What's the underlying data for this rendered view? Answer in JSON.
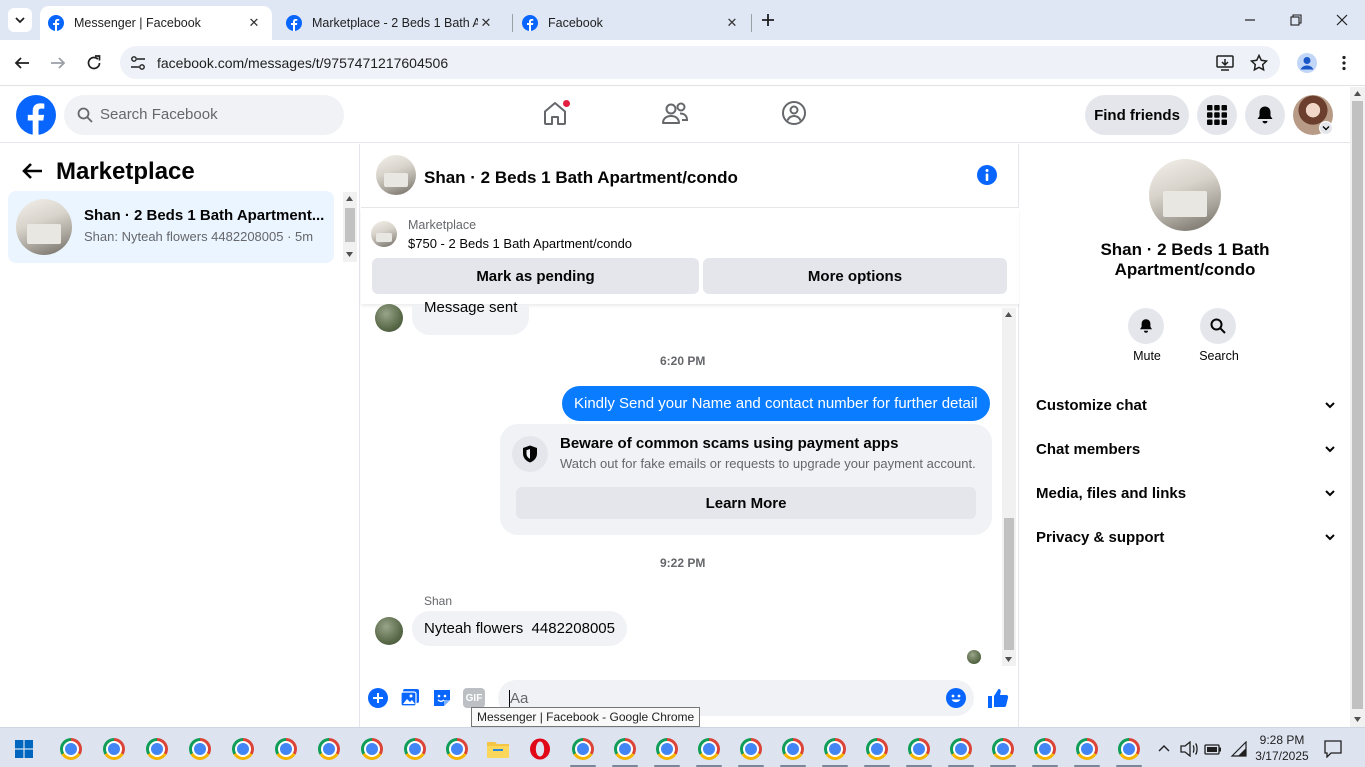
{
  "browser": {
    "tabs": [
      {
        "title": "Messenger | Facebook",
        "active": true
      },
      {
        "title": "Marketplace - 2 Beds 1 Bath Ap",
        "active": false
      },
      {
        "title": "Facebook",
        "active": false
      }
    ],
    "url": "facebook.com/messages/t/9757471217604506"
  },
  "fb_header": {
    "search_placeholder": "Search Facebook",
    "find_friends_label": "Find friends",
    "brand_color": "#0866ff"
  },
  "left_panel": {
    "title": "Marketplace",
    "conversation": {
      "name": "Shan · 2 Beds 1 Bath Apartment...",
      "preview": "Shan: Nyteah flowers 4482208005",
      "time": "· 5m"
    }
  },
  "chat": {
    "header_name": "Shan · 2 Beds 1 Bath Apartment/condo",
    "listing": {
      "source": "Marketplace",
      "title": "$750 - 2 Beds 1 Bath Apartment/condo"
    },
    "buttons": {
      "mark_pending": "Mark as pending",
      "more_options": "More options"
    },
    "messages": {
      "partial_sent": "Message sent",
      "time_1": "6:20 PM",
      "outgoing": "Kindly Send your Name and contact number for further detail",
      "scam_warning": {
        "title": "Beware of common scams using payment apps",
        "body": "Watch out for fake emails or requests to upgrade your payment account.",
        "button": "Learn More"
      },
      "time_2": "9:22 PM",
      "sender": "Shan",
      "incoming": "Nyteah flowers  4482208005"
    },
    "composer_placeholder": "Aa"
  },
  "right_panel": {
    "name_line1": "Shan · 2 Beds 1 Bath",
    "name_line2": "Apartment/condo",
    "actions": {
      "mute": "Mute",
      "search": "Search"
    },
    "sections": [
      "Customize chat",
      "Chat members",
      "Media, files and links",
      "Privacy & support"
    ]
  },
  "taskbar": {
    "tooltip": "Messenger | Facebook - Google Chrome",
    "time": "9:28 PM",
    "date": "3/17/2025"
  },
  "colors": {
    "accent": "#0866ff",
    "outgoing_bubble": "#0a7cff",
    "selected_conv_bg": "#ebf5ff"
  }
}
